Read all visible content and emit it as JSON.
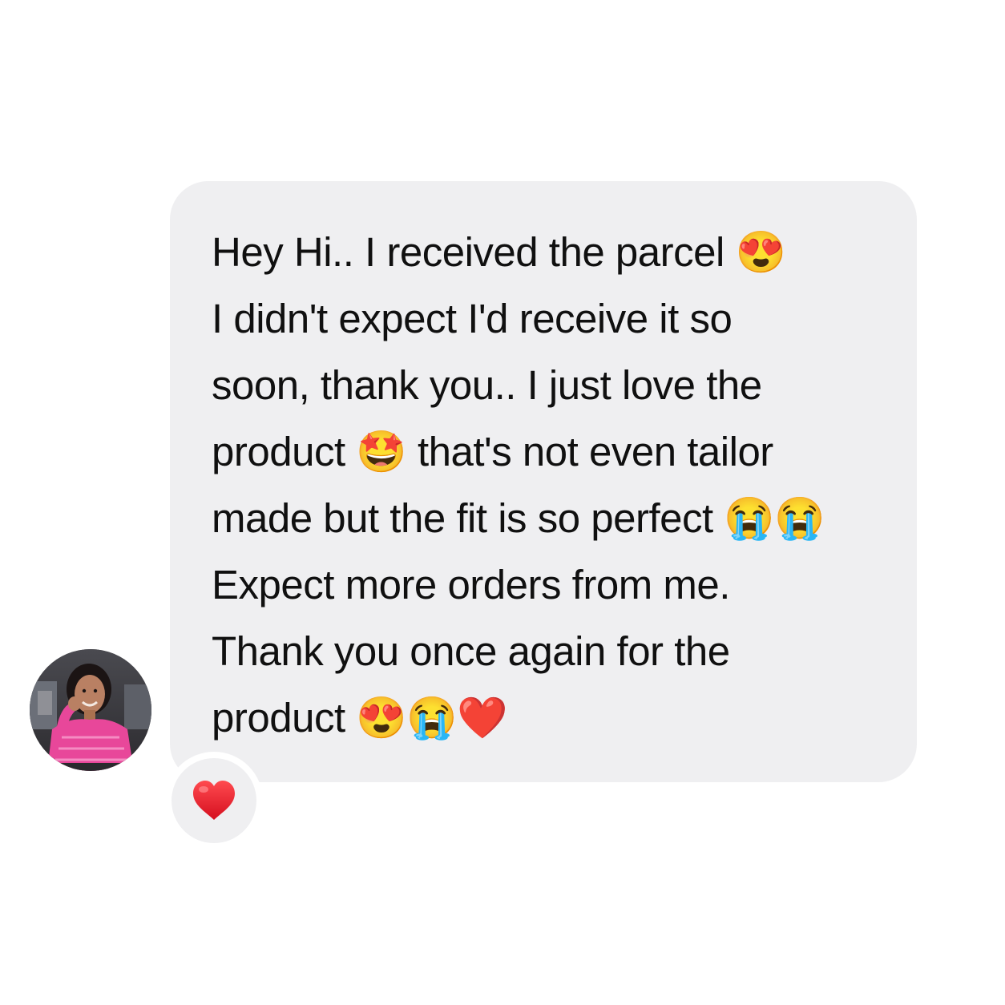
{
  "message": {
    "lines": [
      "Hey Hi.. I received the parcel 😍",
      "I didn't expect I'd receive it so",
      "soon, thank you.. I just love the",
      "product 🤩 that's not even tailor",
      "made but the fit is so perfect 😭😭",
      "Expect more orders from me.",
      "Thank you once again for the",
      "product 😍😭❤️"
    ]
  },
  "sender": {
    "avatar_icon": "profile-photo"
  },
  "reaction": {
    "icon": "red-heart-icon",
    "color": "#e8162a"
  },
  "colors": {
    "bubble": "#efeff1",
    "text": "#101010",
    "background": "#ffffff"
  }
}
